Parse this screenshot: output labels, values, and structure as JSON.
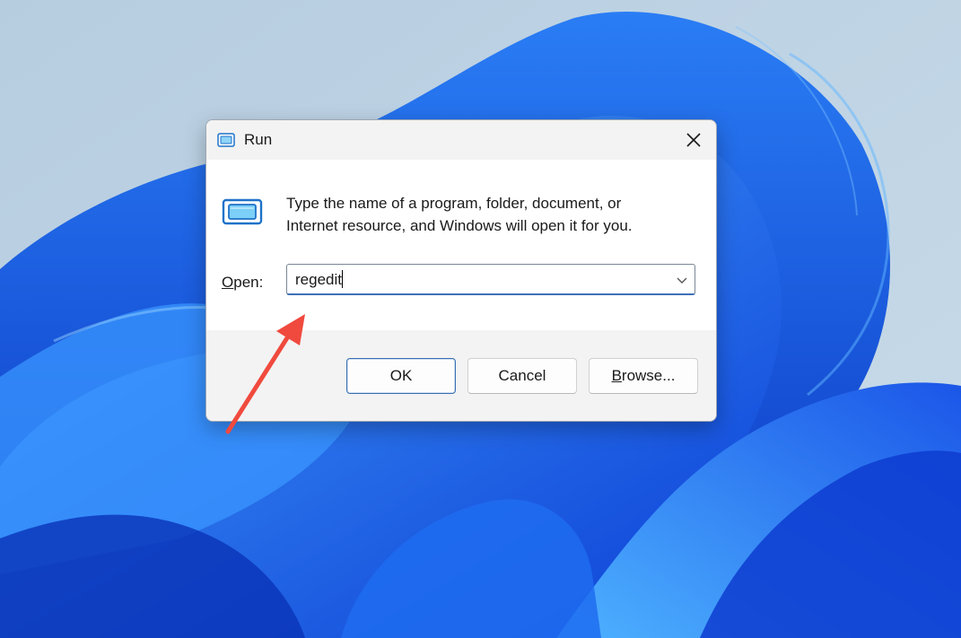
{
  "window": {
    "title": "Run",
    "title_icon": "run-icon",
    "close_icon": "close-icon"
  },
  "body": {
    "icon": "run-program-icon",
    "description_line1": "Type the name of a program, folder, document, or",
    "description_line2": "Internet resource, and Windows will open it for you.",
    "open_label_accel": "O",
    "open_label_rest": "pen:",
    "input_value": "regedit",
    "dropdown_icon": "chevron-down-icon"
  },
  "footer": {
    "ok_label": "OK",
    "cancel_label": "Cancel",
    "browse_accel": "B",
    "browse_rest": "rowse..."
  },
  "annotation": {
    "arrow_color": "#f04a3e",
    "arrow_icon": "red-arrow-annotation"
  },
  "colors": {
    "accent": "#3d6fb6",
    "wallpaper_blue": "#1f5fe0"
  }
}
